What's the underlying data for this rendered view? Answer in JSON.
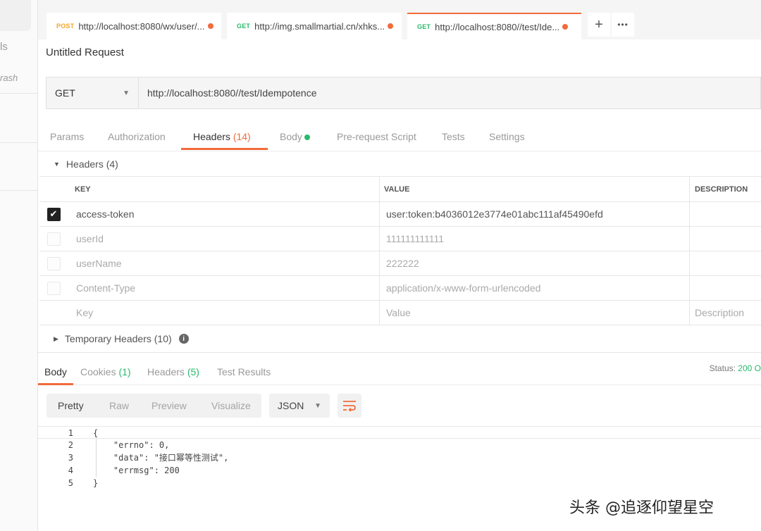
{
  "sidebar": {
    "partial_labels": [
      "ls",
      "rash"
    ]
  },
  "tabs": [
    {
      "method": "POST",
      "method_color": "#f5a623",
      "url": "http://localhost:8080/wx/user/..."
    },
    {
      "method": "GET",
      "method_color": "#29b96b",
      "url": "http://img.smallmartial.cn/xhks..."
    },
    {
      "method": "GET",
      "method_color": "#29b96b",
      "url": "http://localhost:8080//test/Ide..."
    }
  ],
  "tab_actions": {
    "add_icon": "+",
    "more_icon": "•••"
  },
  "request": {
    "title": "Untitled Request",
    "method": "GET",
    "url": "http://localhost:8080//test/Idempotence"
  },
  "request_tabs": {
    "params": "Params",
    "authorization": "Authorization",
    "headers": "Headers",
    "headers_count": "(14)",
    "body": "Body",
    "pre_request": "Pre-request Script",
    "tests": "Tests",
    "settings": "Settings"
  },
  "headers_section": {
    "title": "Headers (4)",
    "columns": {
      "key": "KEY",
      "value": "VALUE",
      "description": "DESCRIPTION"
    },
    "rows": [
      {
        "checked": true,
        "key": "access-token",
        "value": "user:token:b4036012e3774e01abc111af45490efd"
      },
      {
        "checked": false,
        "key": "userId",
        "value": "111111111111"
      },
      {
        "checked": false,
        "key": "userName",
        "value": "222222"
      },
      {
        "checked": false,
        "key": "Content-Type",
        "value": "application/x-www-form-urlencoded"
      }
    ],
    "placeholders": {
      "key": "Key",
      "value": "Value",
      "description": "Description"
    }
  },
  "temporary_headers": "Temporary Headers (10)",
  "response": {
    "tabs": {
      "body": "Body",
      "cookies": "Cookies",
      "cookies_count": "(1)",
      "headers": "Headers",
      "headers_count": "(5)",
      "test_results": "Test Results"
    },
    "status_label": "Status:",
    "status_value": "200 O",
    "formats": {
      "pretty": "Pretty",
      "raw": "Raw",
      "preview": "Preview",
      "visualize": "Visualize"
    },
    "language": "JSON",
    "code_lines": [
      {
        "n": "1",
        "text": "{"
      },
      {
        "n": "2",
        "text": "    \"errno\": 0,"
      },
      {
        "n": "3",
        "text": "    \"data\": \"接口幂等性测试\","
      },
      {
        "n": "4",
        "text": "    \"errmsg\": 200"
      },
      {
        "n": "5",
        "text": "}"
      }
    ]
  },
  "watermark": "头条 @追逐仰望星空",
  "colors": {
    "accent": "#f26b3a",
    "success": "#29b96b",
    "post": "#f5a623"
  }
}
